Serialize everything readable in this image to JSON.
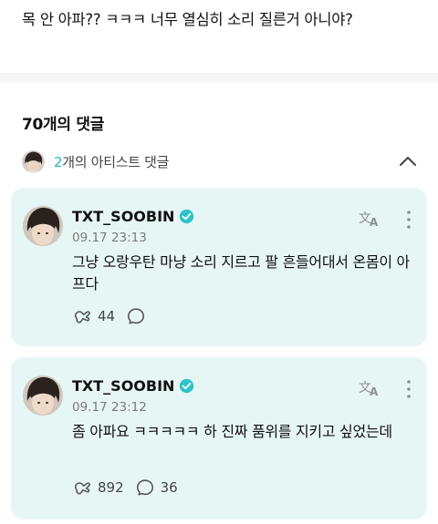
{
  "post": {
    "text": "목 안 아파?? ㅋㅋㅋ 너무 열심히 소리 질른거 아니야?"
  },
  "comments_header": {
    "count_label": "70개의 댓글"
  },
  "artist_section": {
    "count": "2",
    "label_suffix": "개의 아티스트 댓글"
  },
  "colors": {
    "accent": "#1fb9c4",
    "card_bg": "#e6f6f4",
    "verified": "#2ec2c9"
  },
  "comments": [
    {
      "username": "TXT_SOOBIN",
      "timestamp": "09.17 23:13",
      "text": "그냥 오랑우탄 마냥 소리 지르고 팔 흔들어대서 온몸이 아프다",
      "likes": "44",
      "replies": ""
    },
    {
      "username": "TXT_SOOBIN",
      "timestamp": "09.17 23:12",
      "text": "좀 아파요 ㅋㅋㅋㅋㅋ 하 진짜 품위를 지키고 싶었는데",
      "likes": "892",
      "replies": "36"
    }
  ]
}
